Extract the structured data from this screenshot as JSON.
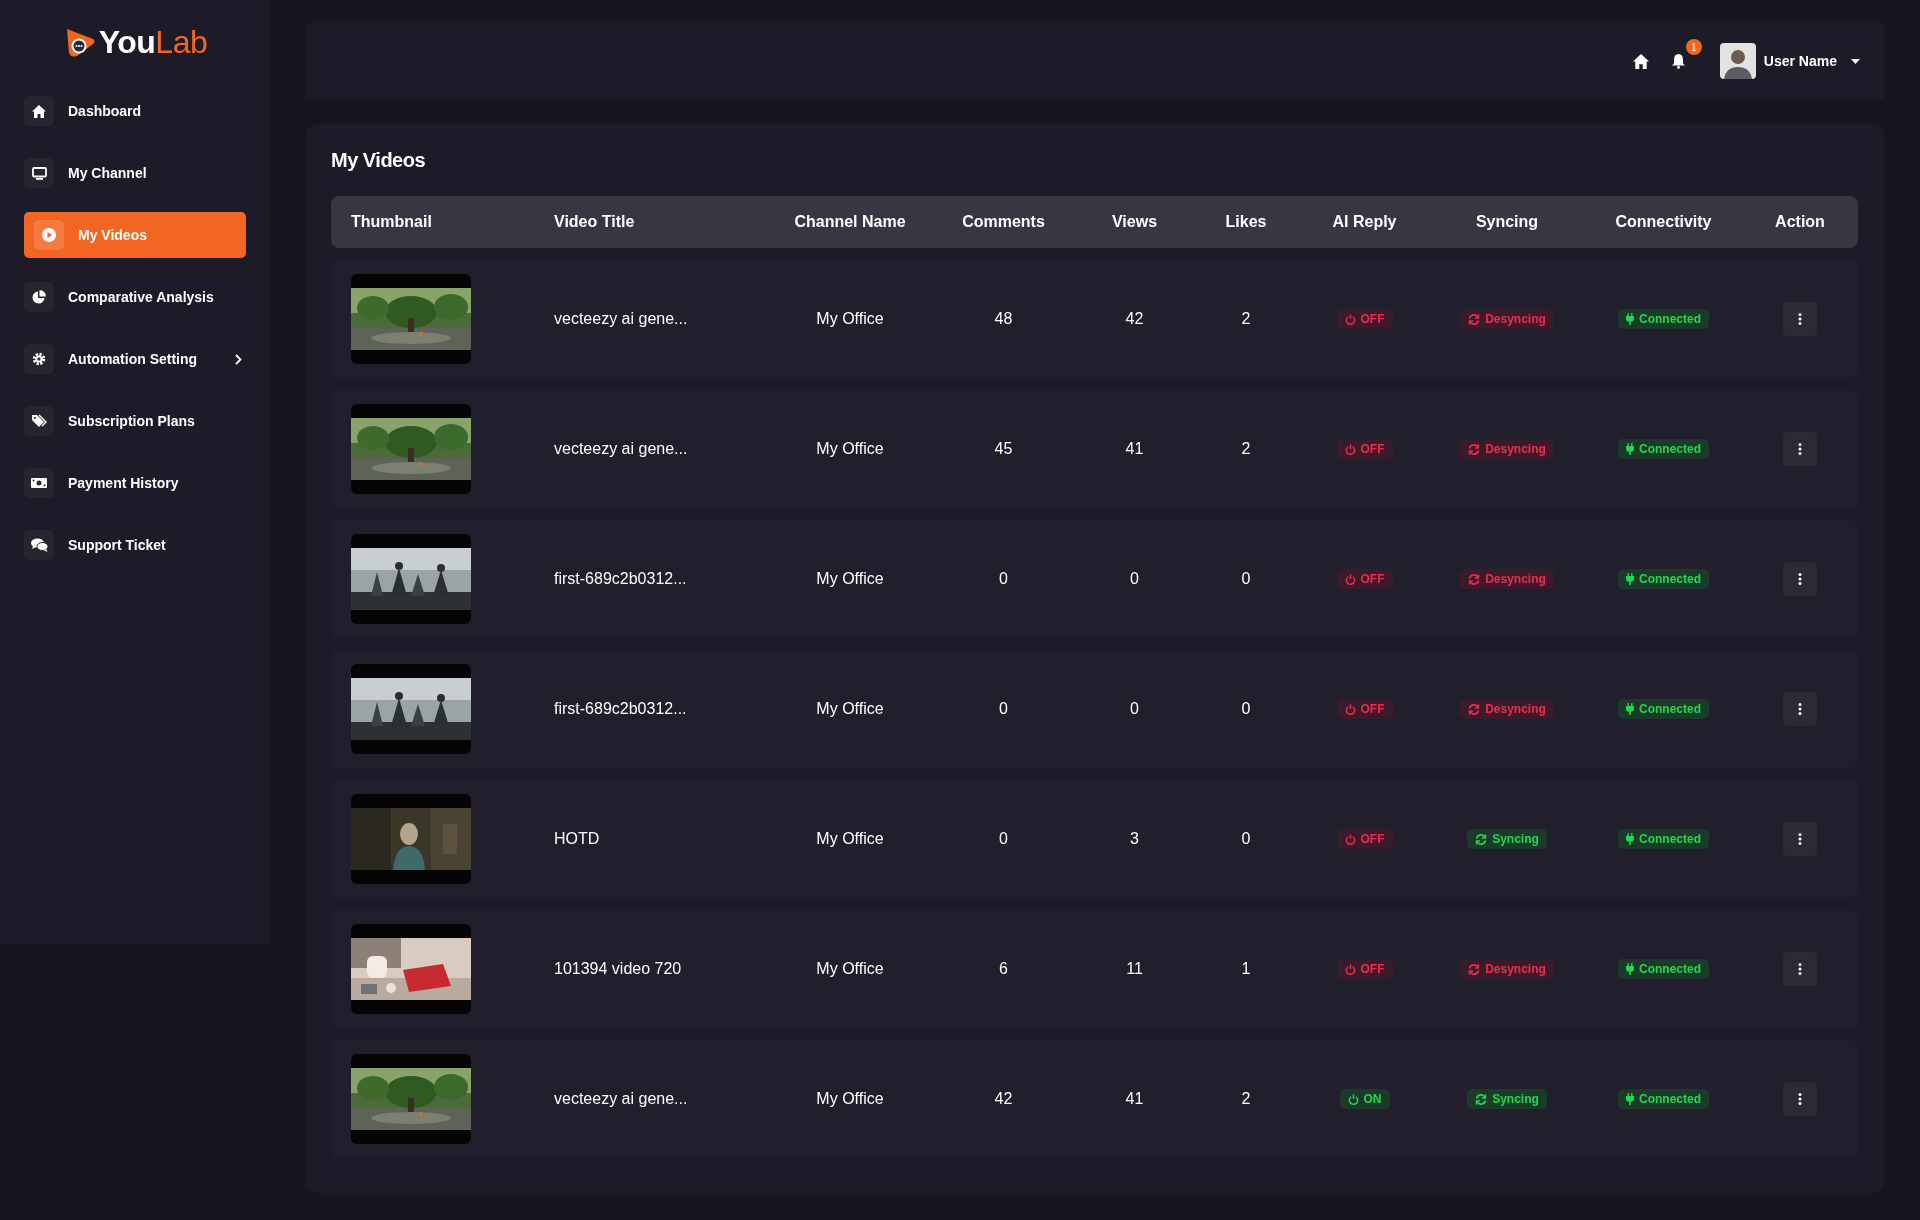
{
  "logo_text": [
    "You",
    "Lab"
  ],
  "sidebar": {
    "items": [
      {
        "label": "Dashboard",
        "kind": "link",
        "selected": false
      },
      {
        "label": "My Channel",
        "kind": "link",
        "selected": false
      },
      {
        "label": "My Videos",
        "kind": "link",
        "selected": true
      },
      {
        "label": "Comparative Analysis",
        "kind": "link",
        "selected": false
      },
      {
        "label": "Automation Setting",
        "kind": "submenu",
        "selected": false
      },
      {
        "label": "Subscription Plans",
        "kind": "link",
        "selected": false
      },
      {
        "label": "Payment History",
        "kind": "link",
        "selected": false
      },
      {
        "label": "Support Ticket",
        "kind": "link",
        "selected": false
      }
    ]
  },
  "header": {
    "notification_count": "1",
    "user_name": "User Name"
  },
  "page_title": "My Videos",
  "table": {
    "columns": [
      "Thumbnail",
      "Video Title",
      "Channel Name",
      "Comments",
      "Views",
      "Likes",
      "AI Reply",
      "Syncing",
      "Connectivity",
      "Action"
    ],
    "rows": [
      {
        "title": "vecteezy ai gene...",
        "channel": "My Office",
        "comments": "48",
        "views": "42",
        "likes": "2",
        "ai_reply": {
          "label": "OFF",
          "on": false
        },
        "syncing": {
          "label": "Desyncing",
          "on": false
        },
        "connectivity": {
          "label": "Connected",
          "on": true
        }
      },
      {
        "title": "vecteezy ai gene...",
        "channel": "My Office",
        "comments": "45",
        "views": "41",
        "likes": "2",
        "ai_reply": {
          "label": "OFF",
          "on": false
        },
        "syncing": {
          "label": "Desyncing",
          "on": false
        },
        "connectivity": {
          "label": "Connected",
          "on": true
        }
      },
      {
        "title": "first-689c2b0312...",
        "channel": "My Office",
        "comments": "0",
        "views": "0",
        "likes": "0",
        "ai_reply": {
          "label": "OFF",
          "on": false
        },
        "syncing": {
          "label": "Desyncing",
          "on": false
        },
        "connectivity": {
          "label": "Connected",
          "on": true
        }
      },
      {
        "title": "first-689c2b0312...",
        "channel": "My Office",
        "comments": "0",
        "views": "0",
        "likes": "0",
        "ai_reply": {
          "label": "OFF",
          "on": false
        },
        "syncing": {
          "label": "Desyncing",
          "on": false
        },
        "connectivity": {
          "label": "Connected",
          "on": true
        }
      },
      {
        "title": "HOTD",
        "channel": "My Office",
        "comments": "0",
        "views": "3",
        "likes": "0",
        "ai_reply": {
          "label": "OFF",
          "on": false
        },
        "syncing": {
          "label": "Syncing",
          "on": true
        },
        "connectivity": {
          "label": "Connected",
          "on": true
        }
      },
      {
        "title": "101394 video 720",
        "channel": "My Office",
        "comments": "6",
        "views": "11",
        "likes": "1",
        "ai_reply": {
          "label": "OFF",
          "on": false
        },
        "syncing": {
          "label": "Desyncing",
          "on": false
        },
        "connectivity": {
          "label": "Connected",
          "on": true
        }
      },
      {
        "title": "vecteezy ai gene...",
        "channel": "My Office",
        "comments": "42",
        "views": "41",
        "likes": "2",
        "ai_reply": {
          "label": "ON",
          "on": true
        },
        "syncing": {
          "label": "Syncing",
          "on": true
        },
        "connectivity": {
          "label": "Connected",
          "on": true
        }
      }
    ]
  }
}
